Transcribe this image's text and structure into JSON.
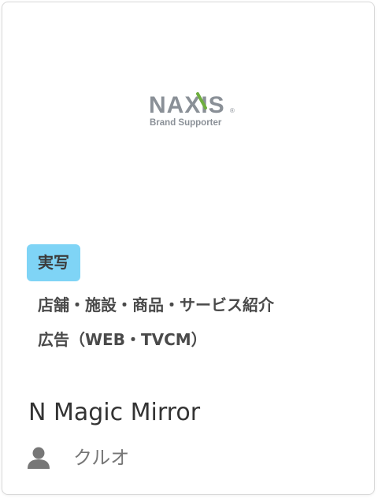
{
  "logo": {
    "wordmark": "NAXIS",
    "registered_mark": "®",
    "tagline": "Brand Supporter",
    "colors": {
      "text_gray": "#8a9097",
      "accent_green": "#6fae3f"
    }
  },
  "badge": {
    "label": "実写",
    "color": "#7fd4f6"
  },
  "tags": [
    "店舗・施設・商品・サービス紹介",
    "広告（WEB・TVCM）"
  ],
  "title": "N Magic Mirror",
  "author": {
    "icon": "user-icon",
    "name": "クルオ"
  }
}
